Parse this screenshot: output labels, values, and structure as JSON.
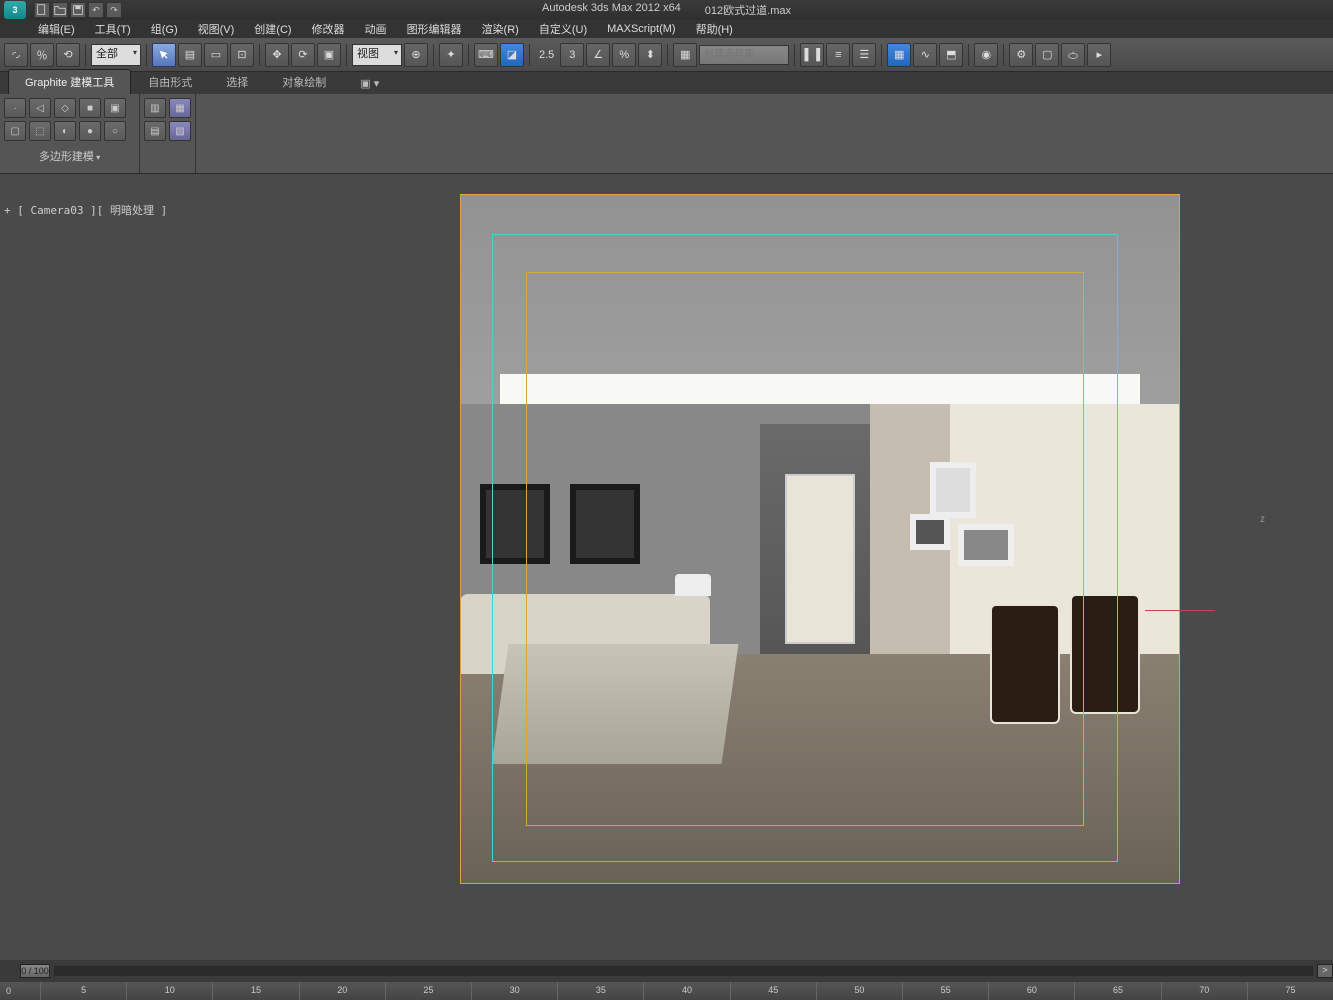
{
  "titlebar": {
    "app_name": "Autodesk 3ds Max  2012 x64",
    "file_name": "012欧式过道.max",
    "qat": [
      "new",
      "open",
      "save",
      "undo",
      "redo"
    ]
  },
  "menubar": {
    "items": [
      "编辑(E)",
      "工具(T)",
      "组(G)",
      "视图(V)",
      "创建(C)",
      "修改器",
      "动画",
      "图形编辑器",
      "渲染(R)",
      "自定义(U)",
      "MAXScript(M)",
      "帮助(H)"
    ]
  },
  "toolbar": {
    "filter_label": "全部",
    "viewmode_label": "视图",
    "spinner_value": "2.5",
    "selection_set_placeholder": "创建选择集"
  },
  "ribbon": {
    "tabs": [
      "Graphite 建模工具",
      "自由形式",
      "选择",
      "对象绘制"
    ],
    "active_tab": 0,
    "poly_label": "多边形建模"
  },
  "viewport": {
    "label": "+ [ Camera03 ][ 明暗处理 ]",
    "axis_z": "z"
  },
  "timeline": {
    "frame_display": "0 / 100",
    "end_btn": ">",
    "ruler_marks": [
      "0",
      "5",
      "10",
      "15",
      "20",
      "25",
      "30",
      "35",
      "40",
      "45",
      "50",
      "55",
      "60",
      "65",
      "70",
      "75"
    ]
  },
  "colors": {
    "accent": "#d4a83a",
    "safe": "#3dd4d4"
  }
}
